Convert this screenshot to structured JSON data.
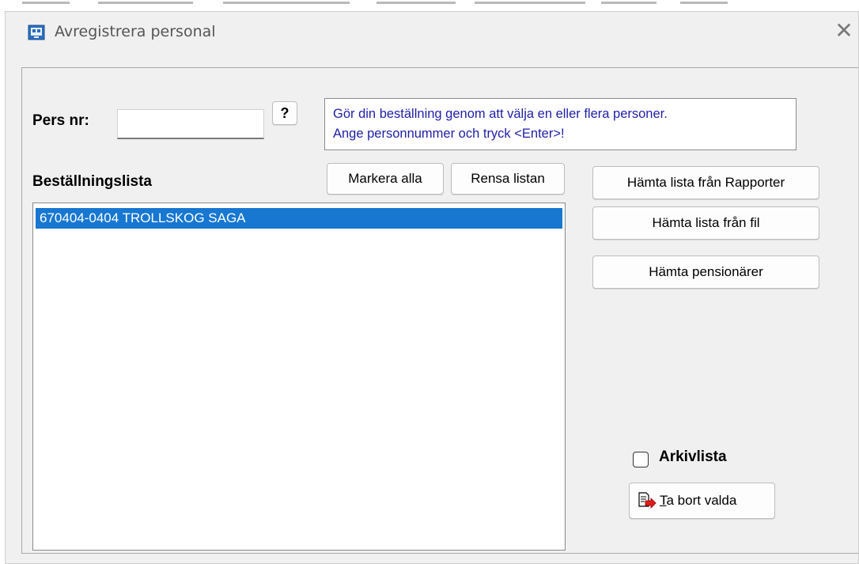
{
  "window": {
    "title": "Avregistrera personal",
    "close_icon": "close-icon"
  },
  "form": {
    "pers_nr_label": "Pers nr:",
    "pers_nr_value": "",
    "help_button_label": "?",
    "info_line1": "Gör din beställning genom att välja en eller flera personer.",
    "info_line2": "Ange personnummer och tryck <Enter>!"
  },
  "order_list": {
    "label": "Beställningslista",
    "mark_all_label": "Markera alla",
    "clear_label": "Rensa listan",
    "items": [
      {
        "text": "670404-0404  TROLLSKOG SAGA",
        "selected": true
      }
    ]
  },
  "side_buttons": {
    "from_reports": "Hämta lista från Rapporter",
    "from_file": "Hämta lista från fil",
    "pensioners": "Hämta pensionärer"
  },
  "archive": {
    "label": "Arkivlista",
    "checked": false
  },
  "remove_button": {
    "label_underlined": "T",
    "label_rest": "a bort valda",
    "icon": "document-arrow-icon"
  },
  "colors": {
    "selection": "#1777d1",
    "info_text": "#1f1fa8",
    "dialog_bg": "#f0f0f0"
  }
}
